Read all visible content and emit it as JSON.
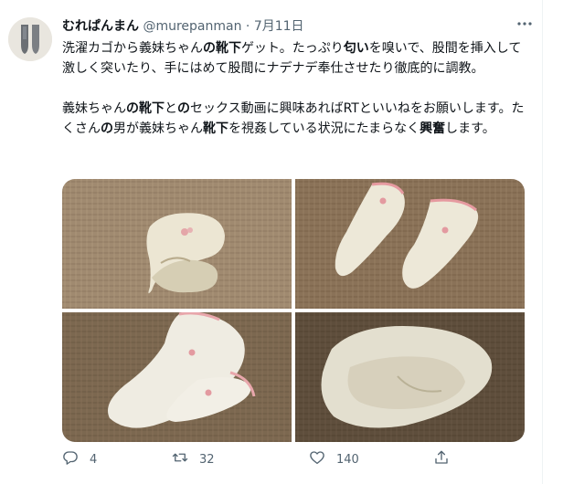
{
  "tweet": {
    "display_name": "むれぱんまん",
    "handle": "@murepanman",
    "separator": "·",
    "date": "7月11日",
    "paragraph1": [
      {
        "t": "洗濯カゴから義妹ちゃん"
      },
      {
        "t": "の靴下",
        "b": true
      },
      {
        "t": "ゲット。たっぷり"
      },
      {
        "t": "匂い",
        "b": true
      },
      {
        "t": "を嗅いで、股間を挿入して激しく突いたり、手にはめて股間にナデナデ奉仕させたり徹底的に調教。"
      }
    ],
    "paragraph2": [
      {
        "t": "義妹ちゃん"
      },
      {
        "t": "の靴下",
        "b": true
      },
      {
        "t": "と"
      },
      {
        "t": "の",
        "b": true
      },
      {
        "t": "セックス動画に興味あればRTといいねをお願いします。たくさん"
      },
      {
        "t": "の",
        "b": true
      },
      {
        "t": "男が義妹ちゃん"
      },
      {
        "t": "靴下",
        "b": true
      },
      {
        "t": "を視姦している状況にたまらなく"
      },
      {
        "t": "興奮",
        "b": true
      },
      {
        "t": "します。"
      }
    ]
  },
  "actions": {
    "reply_count": "4",
    "retweet_count": "32",
    "like_count": "140"
  },
  "icons": {
    "reply": "reply-icon",
    "retweet": "retweet-icon",
    "like": "heart-icon",
    "share": "share-icon",
    "more": "more-icon"
  },
  "colors": {
    "text": "#0f1419",
    "secondary": "#536471"
  }
}
